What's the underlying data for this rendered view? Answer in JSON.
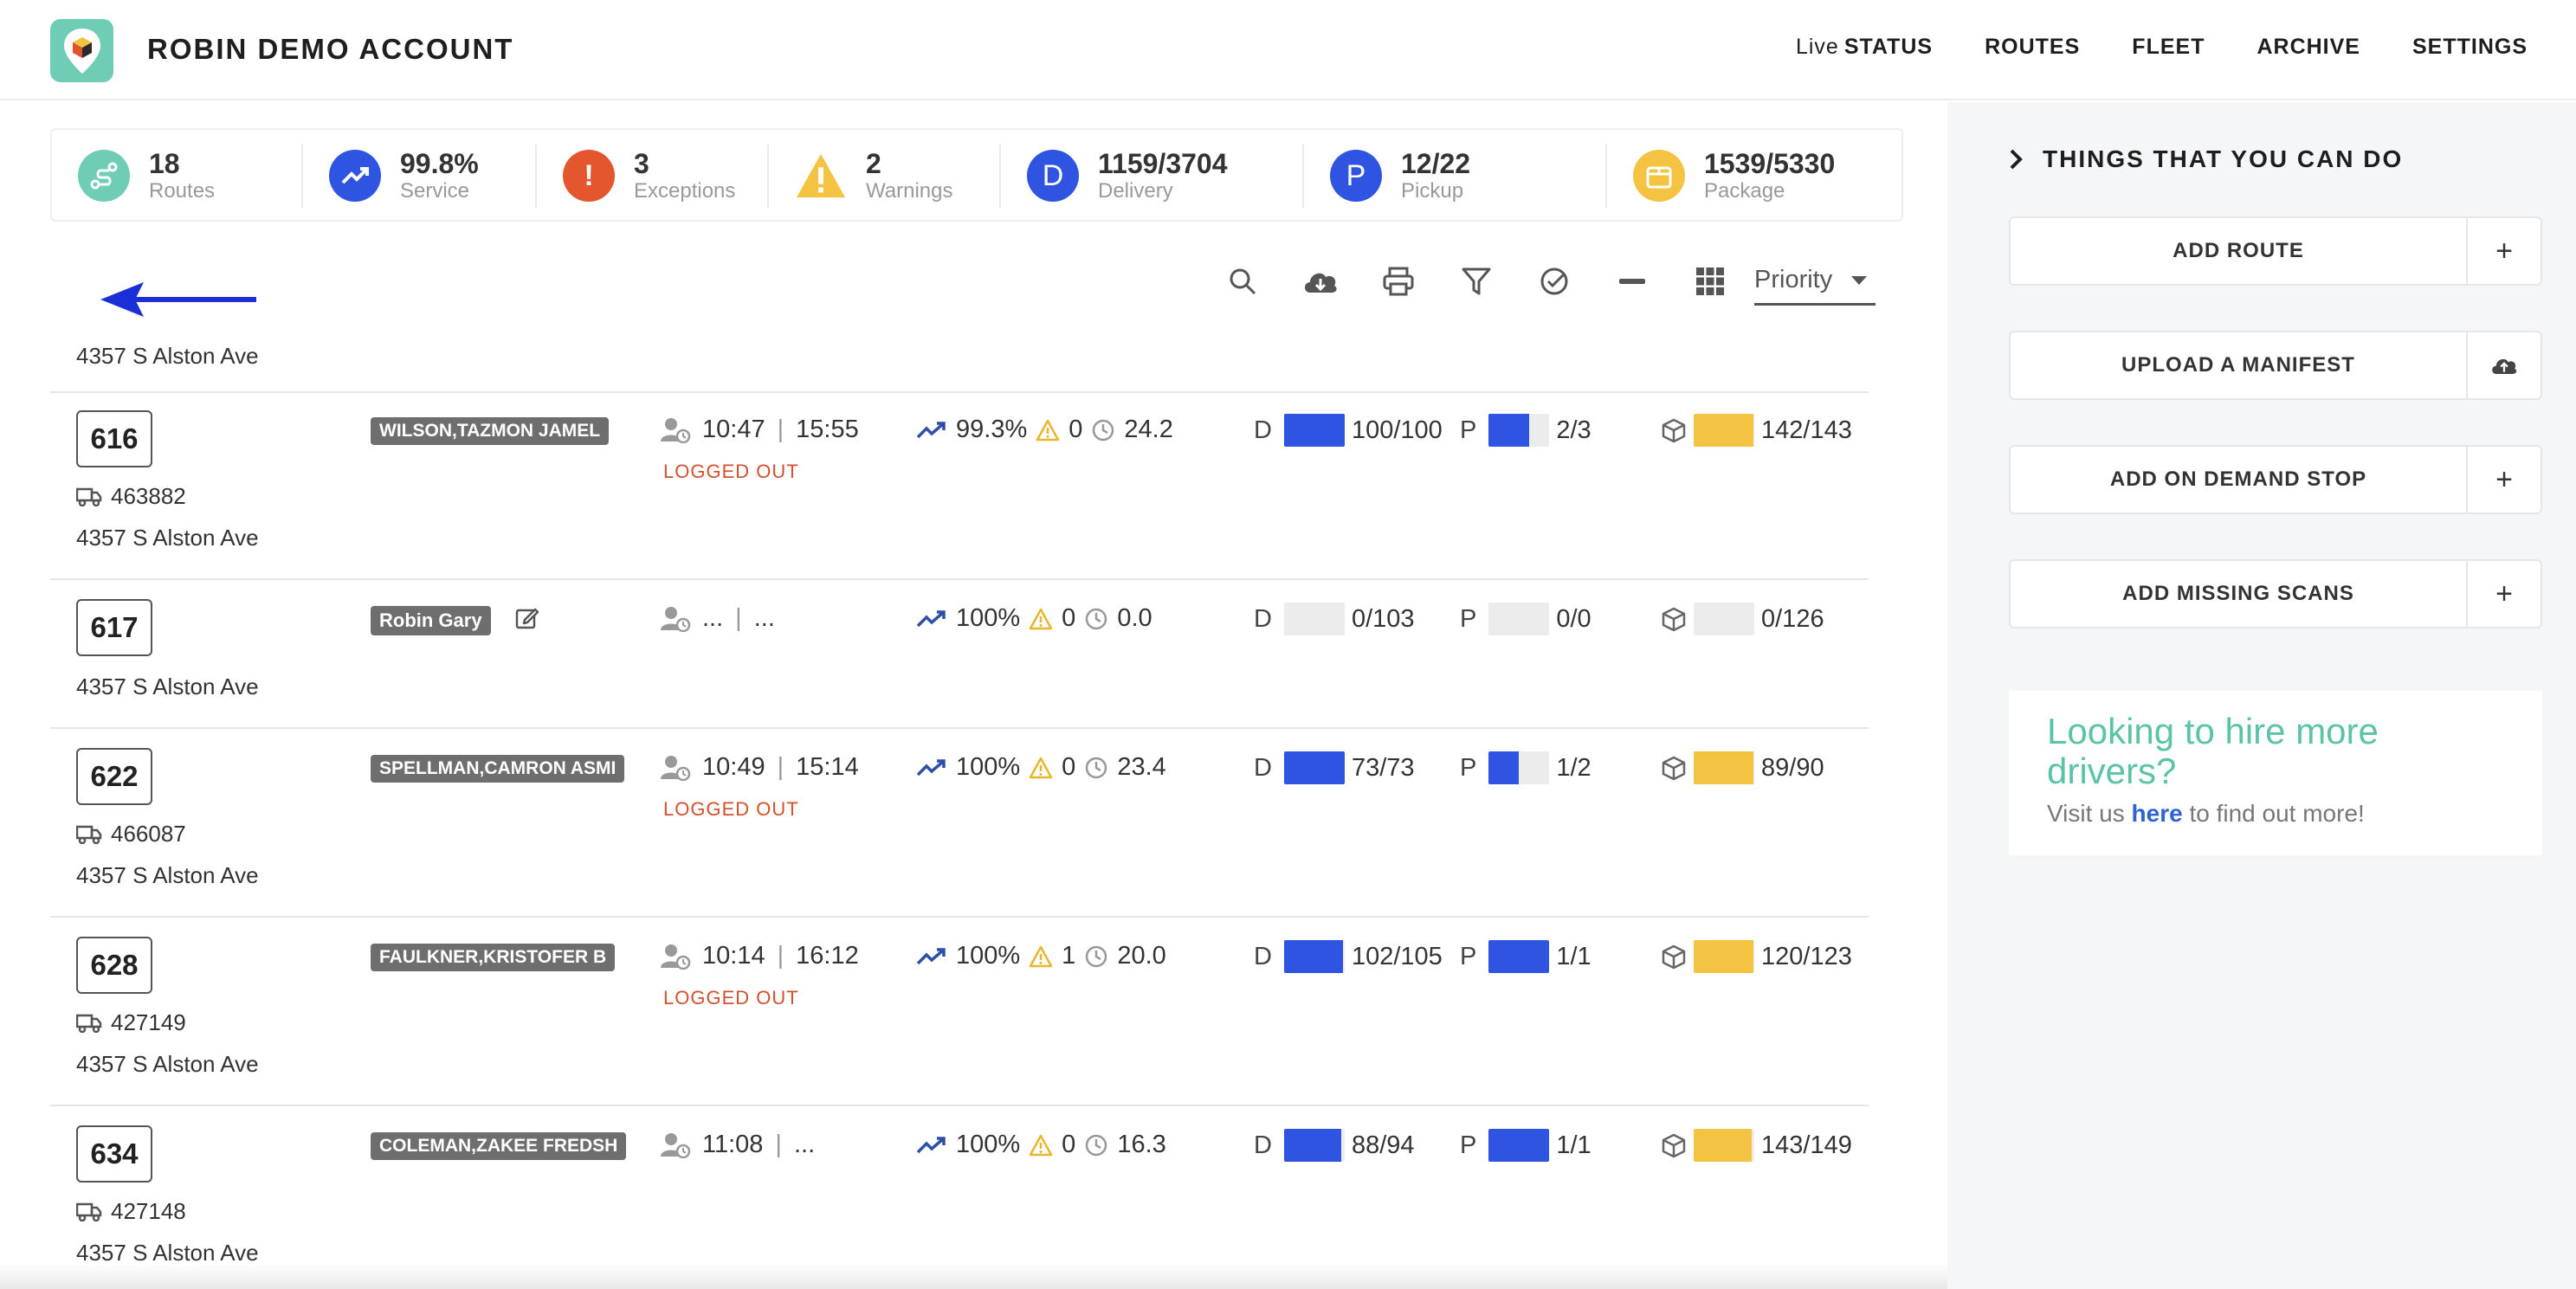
{
  "header": {
    "title": "ROBIN DEMO ACCOUNT",
    "nav": {
      "live_prefix": "Live",
      "status": "STATUS",
      "routes": "ROUTES",
      "fleet": "FLEET",
      "archive": "ARCHIVE",
      "settings": "SETTINGS"
    }
  },
  "stats": [
    {
      "value": "18",
      "label": "Routes",
      "color": "#6fcdb6",
      "icon": "route-icon"
    },
    {
      "value": "99.8%",
      "label": "Service",
      "color": "#2f54e2",
      "icon": "trend-up-icon"
    },
    {
      "value": "3",
      "label": "Exceptions",
      "color": "#e4572e",
      "icon": "exclamation-icon",
      "glyph": "!"
    },
    {
      "value": "2",
      "label": "Warnings",
      "color": "#f5c342",
      "icon": "warning-icon"
    },
    {
      "value": "1159/3704",
      "label": "Delivery",
      "color": "#2f54e2",
      "icon": "delivery-icon",
      "glyph": "D"
    },
    {
      "value": "12/22",
      "label": "Pickup",
      "color": "#2f54e2",
      "icon": "pickup-icon",
      "glyph": "P"
    },
    {
      "value": "1539/5330",
      "label": "Package",
      "color": "#f5c342",
      "icon": "package-icon"
    }
  ],
  "toolbar": {
    "priority_label": "Priority"
  },
  "list": {
    "top_address": "4357 S Alston Ave",
    "rows": [
      {
        "route": "616",
        "vehicle": "463882",
        "address": "4357 S Alston Ave",
        "driver": "WILSON,TAZMON JAMEL",
        "start": "10:47",
        "end": "15:55",
        "status": "LOGGED OUT",
        "service": "99.3%",
        "warnings": "0",
        "duration": "24.2",
        "delivery_letter": "D",
        "delivery": "100/100",
        "delivery_fraction": 1.0,
        "pickup_letter": "P",
        "pickup": "2/3",
        "pickup_fraction": 0.67,
        "package": "142/143",
        "package_fraction": 0.99
      },
      {
        "route": "617",
        "vehicle": "",
        "address": "4357 S Alston Ave",
        "driver": "Robin Gary",
        "start": "...",
        "end": "...",
        "status": "",
        "service": "100%",
        "warnings": "0",
        "duration": "0.0",
        "delivery_letter": "D",
        "delivery": "0/103",
        "delivery_fraction": 0,
        "pickup_letter": "P",
        "pickup": "0/0",
        "pickup_fraction": 0,
        "package": "0/126",
        "package_fraction": 0
      },
      {
        "route": "622",
        "vehicle": "466087",
        "address": "4357 S Alston Ave",
        "driver": "SPELLMAN,CAMRON ASMI",
        "start": "10:49",
        "end": "15:14",
        "status": "LOGGED OUT",
        "service": "100%",
        "warnings": "0",
        "duration": "23.4",
        "delivery_letter": "D",
        "delivery": "73/73",
        "delivery_fraction": 1.0,
        "pickup_letter": "P",
        "pickup": "1/2",
        "pickup_fraction": 0.5,
        "package": "89/90",
        "package_fraction": 0.99
      },
      {
        "route": "628",
        "vehicle": "427149",
        "address": "4357 S Alston Ave",
        "driver": "FAULKNER,KRISTOFER B",
        "start": "10:14",
        "end": "16:12",
        "status": "LOGGED OUT",
        "service": "100%",
        "warnings": "1",
        "duration": "20.0",
        "delivery_letter": "D",
        "delivery": "102/105",
        "delivery_fraction": 0.97,
        "pickup_letter": "P",
        "pickup": "1/1",
        "pickup_fraction": 1.0,
        "package": "120/123",
        "package_fraction": 0.98
      },
      {
        "route": "634",
        "vehicle": "427148",
        "address": "4357 S Alston Ave",
        "driver": "COLEMAN,ZAKEE FREDSH",
        "start": "11:08",
        "end": "...",
        "status": "",
        "service": "100%",
        "warnings": "0",
        "duration": "16.3",
        "delivery_letter": "D",
        "delivery": "88/94",
        "delivery_fraction": 0.94,
        "pickup_letter": "P",
        "pickup": "1/1",
        "pickup_fraction": 1.0,
        "package": "143/149",
        "package_fraction": 0.96
      }
    ]
  },
  "right_panel": {
    "title": "THINGS THAT YOU CAN DO",
    "actions": [
      {
        "label": "ADD ROUTE",
        "icon": "plus-icon"
      },
      {
        "label": "UPLOAD A MANIFEST",
        "icon": "cloud-upload-icon"
      },
      {
        "label": "ADD ON DEMAND STOP",
        "icon": "plus-icon"
      },
      {
        "label": "ADD MISSING SCANS",
        "icon": "plus-icon"
      }
    ],
    "hire": {
      "title": "Looking to hire more drivers?",
      "sub_prefix": "Visit us",
      "link": "here",
      "sub_suffix": "to find out more!"
    }
  },
  "colors": {
    "delivery_fill": "#2f54e2",
    "pickup_fill": "#2f54e2",
    "package_fill": "#f5c342",
    "accent": "#6fcdb6"
  }
}
